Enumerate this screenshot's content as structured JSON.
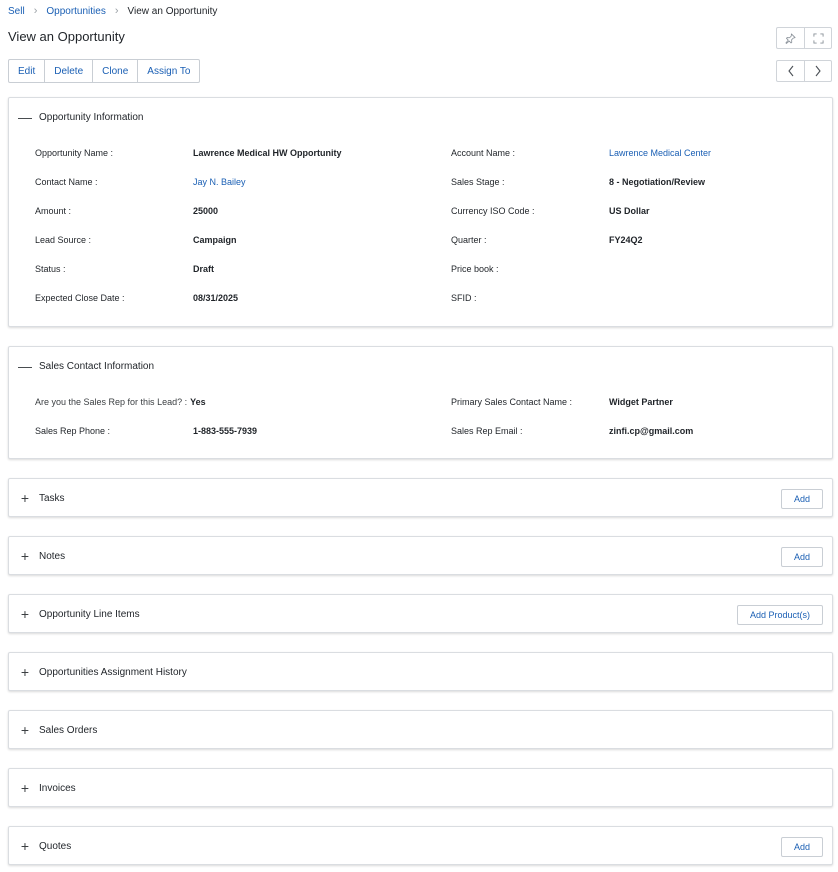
{
  "breadcrumb": {
    "items": [
      "Sell",
      "Opportunities",
      "View an Opportunity"
    ]
  },
  "page": {
    "title": "View an Opportunity"
  },
  "actions": [
    "Edit",
    "Delete",
    "Clone",
    "Assign To"
  ],
  "icons": {
    "pin": "pin-icon",
    "expand": "expand-icon",
    "prev": "chevron-left-icon",
    "next": "chevron-right-icon",
    "collapse": "minus-icon",
    "expand_section": "plus-icon"
  },
  "opportunity_info": {
    "title": "Opportunity Information",
    "left": [
      {
        "label": "Opportunity Name :",
        "value": "Lawrence Medical HW Opportunity"
      },
      {
        "label": "Contact Name :",
        "value": "Jay N. Bailey"
      },
      {
        "label": "Amount :",
        "value": "25000"
      },
      {
        "label": "Lead Source :",
        "value": "Campaign"
      },
      {
        "label": "Status :",
        "value": "Draft"
      },
      {
        "label": "Expected Close Date :",
        "value": "08/31/2025"
      }
    ],
    "right": [
      {
        "label": "Account Name :",
        "value": "Lawrence Medical Center"
      },
      {
        "label": "Sales Stage :",
        "value": "8 - Negotiation/Review"
      },
      {
        "label": "Currency ISO Code :",
        "value": "US Dollar"
      },
      {
        "label": "Quarter :",
        "value": "FY24Q2"
      },
      {
        "label": "Price book :",
        "value": ""
      },
      {
        "label": "SFID :",
        "value": ""
      }
    ]
  },
  "sales_contact": {
    "title": "Sales Contact Information",
    "left": [
      {
        "label": "Are you the Sales Rep for this Lead? :",
        "value": "Yes"
      },
      {
        "label": "Sales Rep Phone :",
        "value": "1-883-555-7939"
      }
    ],
    "right": [
      {
        "label": "Primary Sales Contact Name :",
        "value": "Widget Partner"
      },
      {
        "label": "Sales Rep Email :",
        "value": "zinfi.cp@gmail.com"
      }
    ]
  },
  "sections": [
    {
      "title": "Tasks",
      "button": "Add"
    },
    {
      "title": "Notes",
      "button": "Add"
    },
    {
      "title": "Opportunity Line Items",
      "button": "Add Product(s)"
    },
    {
      "title": "Opportunities Assignment History",
      "button": ""
    },
    {
      "title": "Sales Orders",
      "button": ""
    },
    {
      "title": "Invoices",
      "button": ""
    },
    {
      "title": "Quotes",
      "button": "Add"
    }
  ],
  "colors": {
    "link": "#1a5fb4",
    "border": "#dadde1",
    "text": "#1f2328"
  }
}
